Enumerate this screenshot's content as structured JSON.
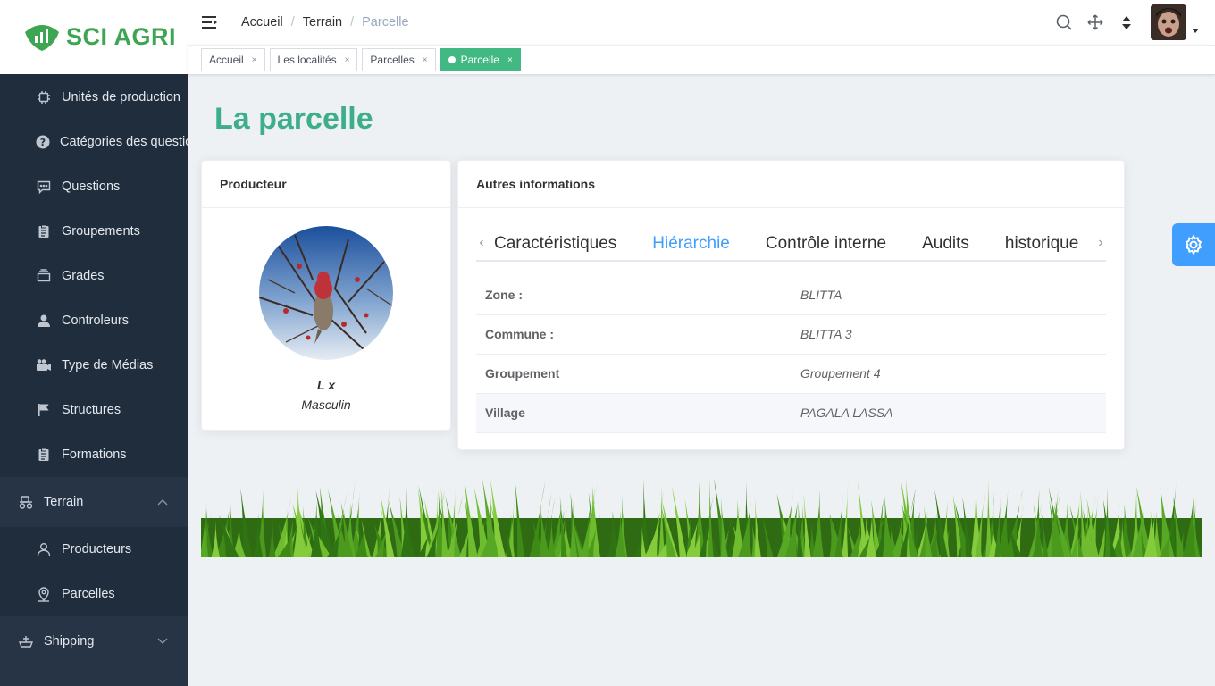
{
  "brand": {
    "name": "SCI AGRI",
    "color": "#3ea553"
  },
  "sidebar": {
    "items": [
      {
        "label": "Unités de production",
        "icon": "chip-icon"
      },
      {
        "label": "Catégories des questions",
        "icon": "question-circle-icon"
      },
      {
        "label": "Questions",
        "icon": "chat-icon"
      },
      {
        "label": "Groupements",
        "icon": "clipboard-icon"
      },
      {
        "label": "Grades",
        "icon": "box-icon"
      },
      {
        "label": "Controleurs",
        "icon": "user-icon"
      },
      {
        "label": "Type de Médias",
        "icon": "camera-icon"
      },
      {
        "label": "Structures",
        "icon": "flag-icon"
      },
      {
        "label": "Formations",
        "icon": "clipboard-icon"
      }
    ],
    "terrain": {
      "label": "Terrain",
      "icon": "tractor-icon",
      "children": [
        {
          "label": "Producteurs",
          "icon": "user-outline-icon"
        },
        {
          "label": "Parcelles",
          "icon": "location-icon"
        }
      ]
    },
    "shipping": {
      "label": "Shipping",
      "icon": "ship-icon"
    }
  },
  "header": {
    "breadcrumb": [
      "Accueil",
      "Terrain",
      "Parcelle"
    ],
    "separator": "/"
  },
  "tags": [
    {
      "label": "Accueil",
      "active": false
    },
    {
      "label": "Les localités",
      "active": false
    },
    {
      "label": "Parcelles",
      "active": false
    },
    {
      "label": "Parcelle",
      "active": true
    }
  ],
  "tag_close": "×",
  "page": {
    "title": "La parcelle"
  },
  "producer_card": {
    "title": "Producteur",
    "name": "L x",
    "gender": "Masculin"
  },
  "info_card": {
    "title": "Autres informations",
    "tabs": [
      "Caractéristiques",
      "Hiérarchie",
      "Contrôle interne",
      "Audits",
      "historique"
    ],
    "active_tab": "Hiérarchie",
    "rows": [
      {
        "key": "Zone :",
        "value": "BLITTA"
      },
      {
        "key": "Commune :",
        "value": "BLITTA 3"
      },
      {
        "key": "Groupement",
        "value": "Groupement 4"
      },
      {
        "key": "Village",
        "value": "PAGALA LASSA"
      }
    ]
  },
  "colors": {
    "sidebar_bg": "#1f2d3d",
    "title_green": "#3eae8a",
    "active_tag": "#42b983",
    "accent_blue": "#409eff"
  }
}
